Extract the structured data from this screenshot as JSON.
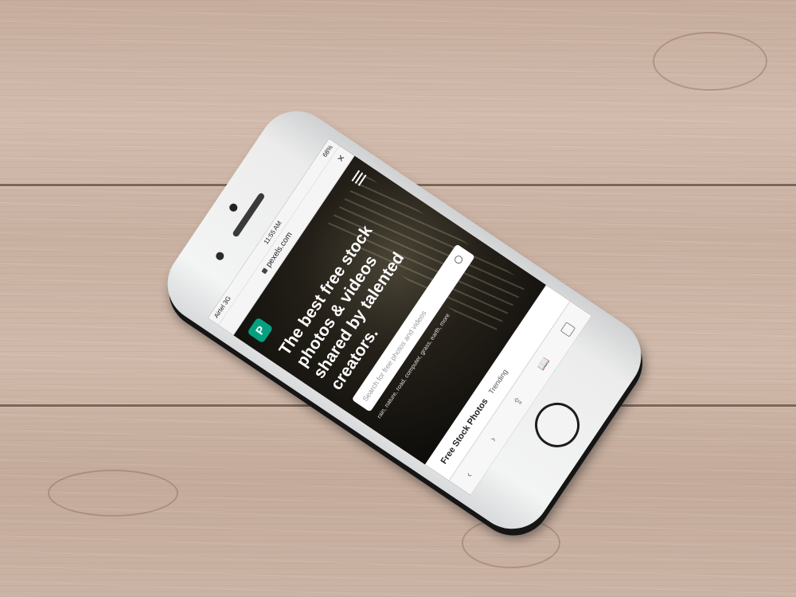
{
  "status_bar": {
    "carrier": "Airtel 3G",
    "time": "11:55 AM",
    "battery": "68%"
  },
  "browser": {
    "url": "pexels.com"
  },
  "site": {
    "logo": "P",
    "headline": "The best free stock photos & videos shared by talented creators.",
    "search": {
      "placeholder": "Search for free photos and videos"
    },
    "tags": "rain, nature, road, computer, grass, earth, more",
    "nav": {
      "free_stock_photos": "Free Stock Photos",
      "trending": "Trending"
    }
  },
  "toolbar": {
    "back": "‹",
    "forward": "›",
    "share": "⇪",
    "bookmarks": "📖"
  },
  "colors": {
    "brand": "#05a081",
    "wood": "#cbb3a5"
  }
}
